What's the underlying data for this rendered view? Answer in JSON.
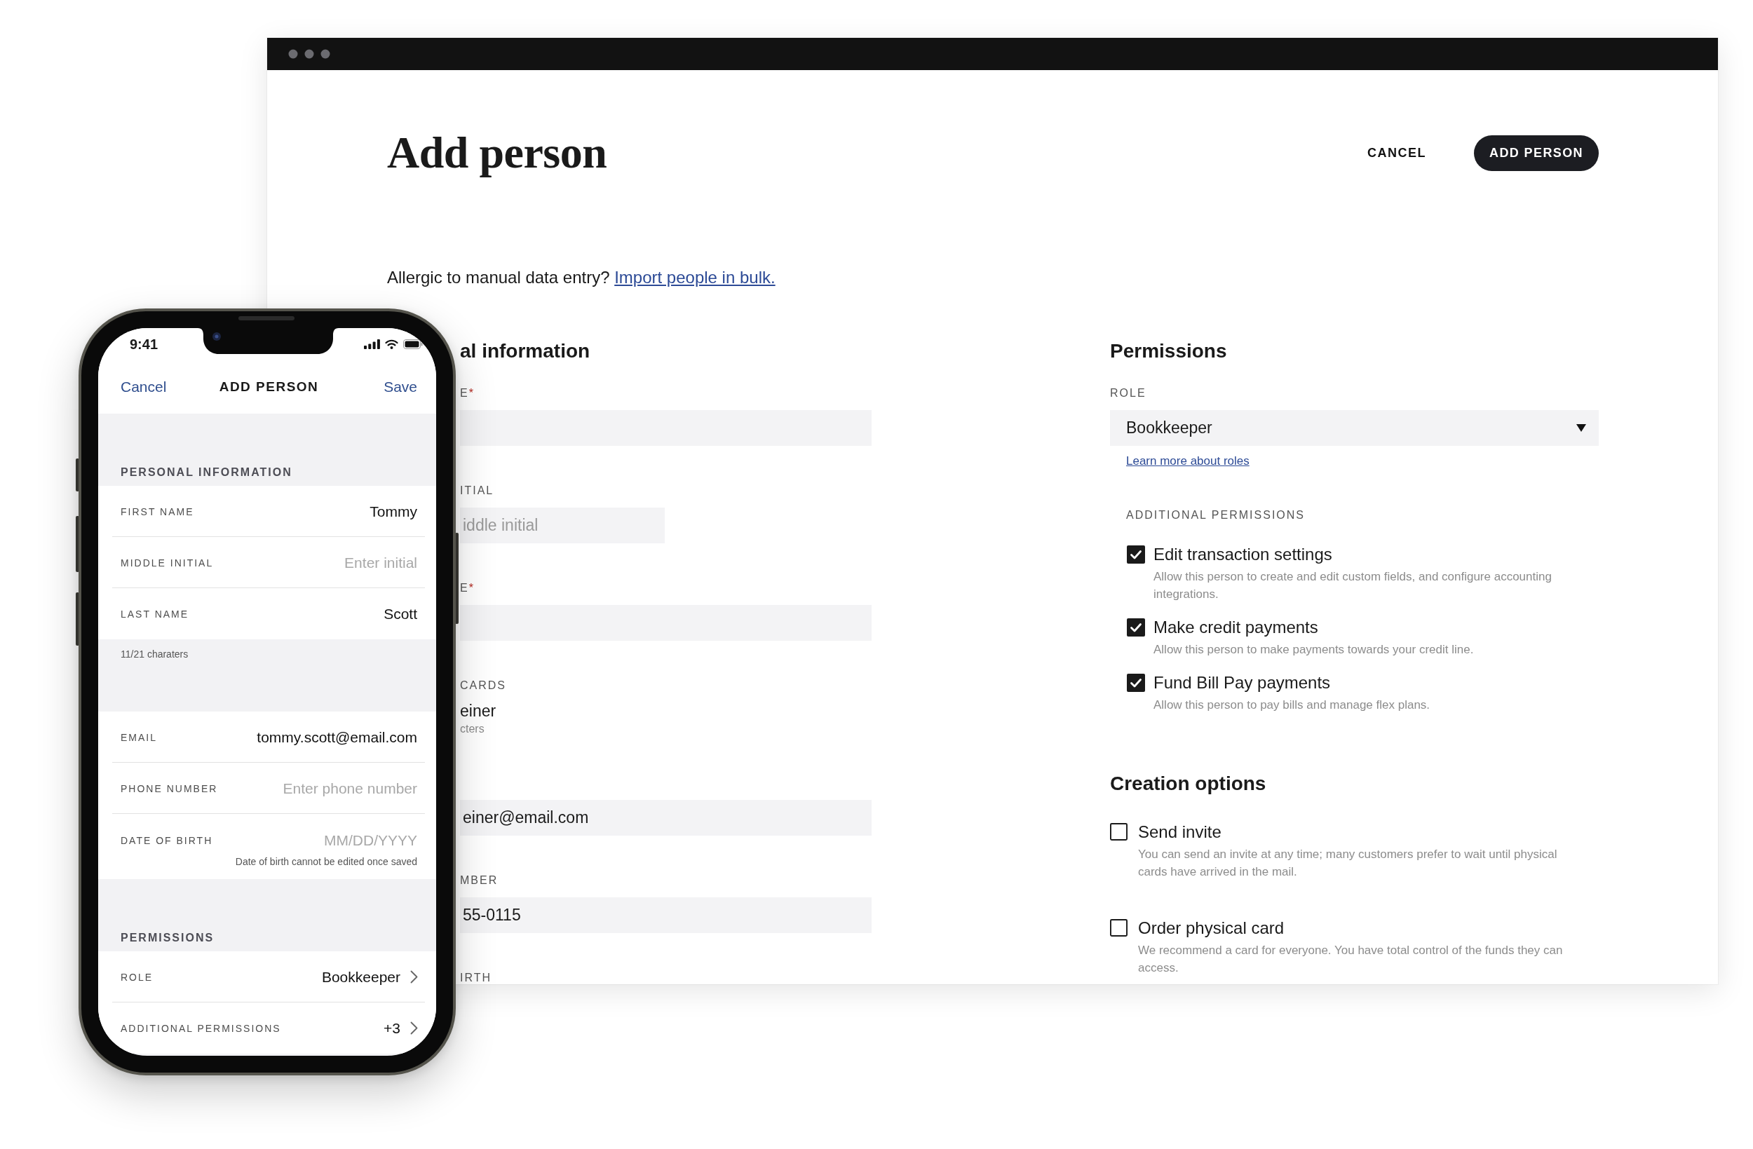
{
  "browser_window": {
    "title": "Add person",
    "actions": [
      {
        "kind": "text",
        "label": "CANCEL"
      },
      {
        "kind": "primary",
        "label": "ADD PERSON"
      }
    ],
    "import_prompt": {
      "text": "Allergic to manual data entry?",
      "link": "Import people in bulk."
    },
    "personal_information": {
      "heading": "al information",
      "fields": [
        {
          "kind": "input",
          "label": "E",
          "required_mark": "*"
        },
        {
          "kind": "input_short",
          "label": "ITIAL",
          "placeholder": "iddle initial"
        },
        {
          "kind": "input",
          "label": "E",
          "required_mark": "*"
        },
        {
          "kind": "text_value",
          "label": "CARDS",
          "value": "einer",
          "hint": "cters"
        },
        {
          "kind": "input",
          "value": "einer@email.com"
        },
        {
          "kind": "input",
          "label": "MBER",
          "value": "55-0115"
        },
        {
          "kind": "label_only",
          "label": "IRTH"
        }
      ]
    },
    "permissions": {
      "heading": "Permissions",
      "role": {
        "label": "ROLE",
        "value": "Bookkeeper",
        "link": "Learn more about roles"
      },
      "additional_permissions": {
        "label": "ADDITIONAL PERMISSIONS",
        "items": [
          {
            "label": "Edit transaction settings",
            "description": "Allow this person to create and edit custom fields, and configure accounting integrations.",
            "checked": true
          },
          {
            "label": "Make credit payments",
            "description": "Allow this person to make payments towards your credit line.",
            "checked": true
          },
          {
            "label": "Fund Bill Pay payments",
            "description": "Allow this person to pay bills and manage flex plans.",
            "checked": true
          }
        ]
      }
    },
    "creation_options": {
      "heading": "Creation options",
      "items": [
        {
          "label": "Send invite",
          "description": "You can send an invite at any time; many customers prefer to wait until physical cards have arrived in the mail.",
          "checked": false
        },
        {
          "label": "Order physical card",
          "description": "We recommend a card for everyone. You have total control of the funds they can access.",
          "checked": false
        }
      ]
    }
  },
  "phone": {
    "status_bar": {
      "time": "9:41"
    },
    "nav_bar": {
      "left_action": "Cancel",
      "title": "ADD PERSON",
      "right_action": "Save"
    },
    "sections": [
      {
        "heading": "PERSONAL INFORMATION",
        "rows": [
          {
            "kind": "field",
            "label": "FIRST NAME",
            "value": "Tommy"
          },
          {
            "kind": "field",
            "label": "MIDDLE INITIAL",
            "placeholder": "Enter initial"
          },
          {
            "kind": "field",
            "label": "LAST NAME",
            "value": "Scott"
          }
        ],
        "footnote": "11/21 charaters"
      },
      {
        "rows": [
          {
            "kind": "field",
            "label": "EMAIL",
            "value": "tommy.scott@email.com"
          },
          {
            "kind": "field",
            "label": "PHONE NUMBER",
            "placeholder": "Enter phone number"
          },
          {
            "kind": "field",
            "label": "DATE OF BIRTH",
            "placeholder": "MM/DD/YYYY",
            "hint": "Date of birth cannot be edited once saved"
          }
        ]
      },
      {
        "heading": "PERMISSIONS",
        "rows": [
          {
            "kind": "disclosure",
            "label": "ROLE",
            "value": "Bookkeeper"
          },
          {
            "kind": "disclosure",
            "label": "ADDITIONAL PERMISSIONS",
            "value": "+3"
          }
        ]
      }
    ]
  }
}
